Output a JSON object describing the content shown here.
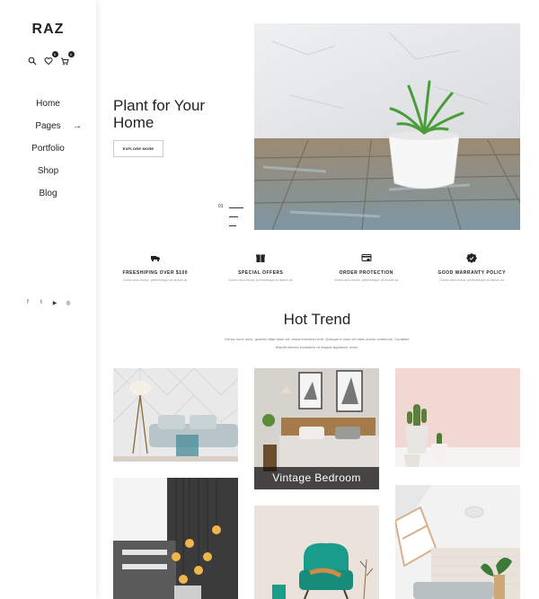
{
  "brand": {
    "logo": "RAZ"
  },
  "header_icons": {
    "search": "search-icon",
    "wishlist": {
      "icon": "heart-icon",
      "count": "0"
    },
    "cart": {
      "icon": "cart-icon",
      "count": "0"
    }
  },
  "menu": [
    {
      "label": "Home"
    },
    {
      "label": "Pages",
      "arrow": "→"
    },
    {
      "label": "Portfolio"
    },
    {
      "label": "Shop"
    },
    {
      "label": "Blog"
    }
  ],
  "social": [
    "f",
    "t",
    "▶",
    "◎"
  ],
  "hero": {
    "title": "Plant for Your Home",
    "button": "EXPLORE MORE",
    "slide_number": "01"
  },
  "features": [
    {
      "icon": "truck-icon",
      "title": "FREESHIPING OVER $100",
      "desc": "Donec arcu lectus, pellentesque at dictum ac"
    },
    {
      "icon": "gift-icon",
      "title": "SPECIAL OFFERS",
      "desc": "Donec arcu lectus, pellentesque at dictum ac"
    },
    {
      "icon": "card-icon",
      "title": "ORDER PROTECTION",
      "desc": "Donec arcu lectus, pellentesque at dictum ac"
    },
    {
      "icon": "badge-icon",
      "title": "GOOD WARRANTY POLICY",
      "desc": "Donec arcu lectus, pellentesque at dictum ac"
    }
  ],
  "hot_trend": {
    "title": "Hot Trend",
    "desc": "Donec nunc nunc, gravida vitae diam vel, varius interdum erat. Quisque a nunc vel diam auctor commodo. Curabitur blandit ultrices excepteur ut magna dignissim, dolor."
  },
  "gallery": {
    "featured_caption": "Vintage Bedroom"
  },
  "colors": {
    "accent": "#222222",
    "caption_bg": "#1f1f1f",
    "teal_chair": "#1a9c8a",
    "pink_wall": "#f2d8d2"
  }
}
